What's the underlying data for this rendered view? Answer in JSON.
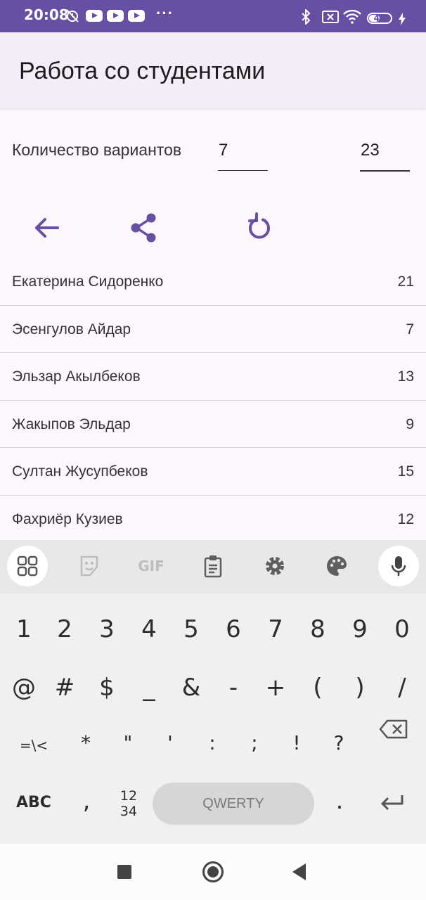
{
  "status_bar": {
    "time": "20:08",
    "battery": "48"
  },
  "app_bar": {
    "title": "Работа со студентами"
  },
  "settings": {
    "count_label": "Количество вариантов",
    "field1_value": "7",
    "field2_value": "23"
  },
  "students": [
    {
      "name": "Екатерина  Сидоренко",
      "variant": "21"
    },
    {
      "name": "Эсенгулов Айдар",
      "variant": "7"
    },
    {
      "name": "Эльзар Акылбеков",
      "variant": "13"
    },
    {
      "name": "Жакыпов Эльдар",
      "variant": "9"
    },
    {
      "name": "Султан Жусупбеков",
      "variant": "15"
    },
    {
      "name": "Фахриёр  Кузиев",
      "variant": "12"
    }
  ],
  "keyboard": {
    "toolbar_gif": "GIF",
    "row1": [
      "1",
      "2",
      "3",
      "4",
      "5",
      "6",
      "7",
      "8",
      "9",
      "0"
    ],
    "row2": [
      "@",
      "#",
      "$",
      "_",
      "&",
      "-",
      "+",
      "(",
      ")",
      "/"
    ],
    "row3": [
      "=\\<",
      "*",
      "\"",
      "'",
      ":",
      ";",
      "!",
      "?"
    ],
    "abc_label": "ABC",
    "comma": ",",
    "num_label_top": "12",
    "num_label_bottom": "34",
    "space_label": "QWERTY",
    "period": "."
  },
  "colors": {
    "primary": "#6750a4",
    "surface": "#fdf7fd",
    "appbar": "#f3edf7"
  }
}
